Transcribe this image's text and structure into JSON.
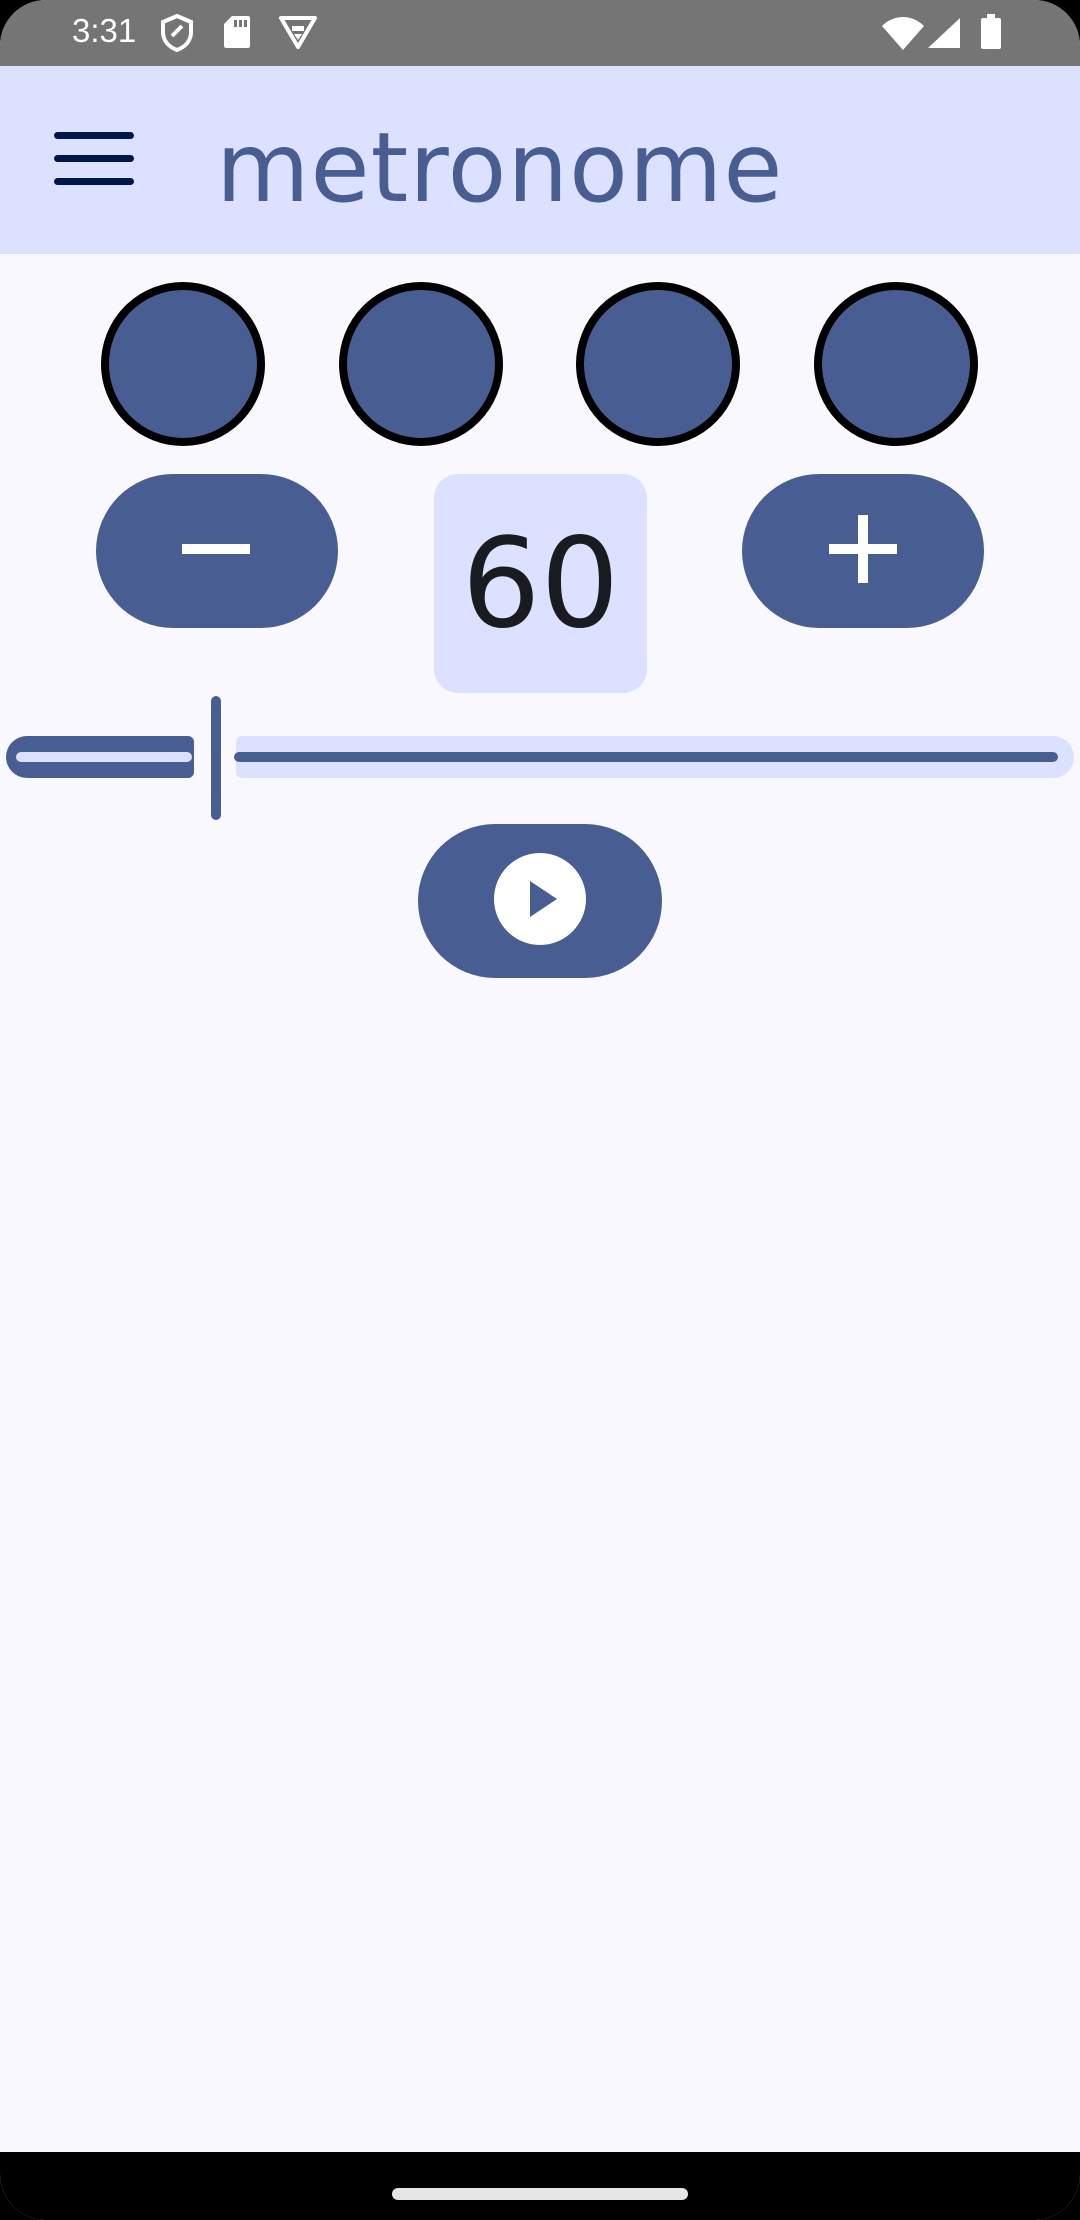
{
  "status_bar": {
    "time": "3:31",
    "icons": [
      "shield-icon",
      "sd-card-icon",
      "vpn-icon",
      "wifi-icon",
      "cell-signal-icon",
      "battery-icon"
    ]
  },
  "app_bar": {
    "title": "metronome",
    "menu_icon": "hamburger-menu-icon"
  },
  "beats": {
    "count": 4,
    "color": "#485d92"
  },
  "tempo": {
    "bpm": "60",
    "decrease_icon": "minus-icon",
    "increase_icon": "plus-icon"
  },
  "slider": {
    "value_fraction": 0.2
  },
  "playback": {
    "icon": "play-circle-icon",
    "state": "stopped"
  },
  "colors": {
    "primary": "#485d92",
    "primary_container": "#dce1ff",
    "background": "#f8f8fe"
  }
}
